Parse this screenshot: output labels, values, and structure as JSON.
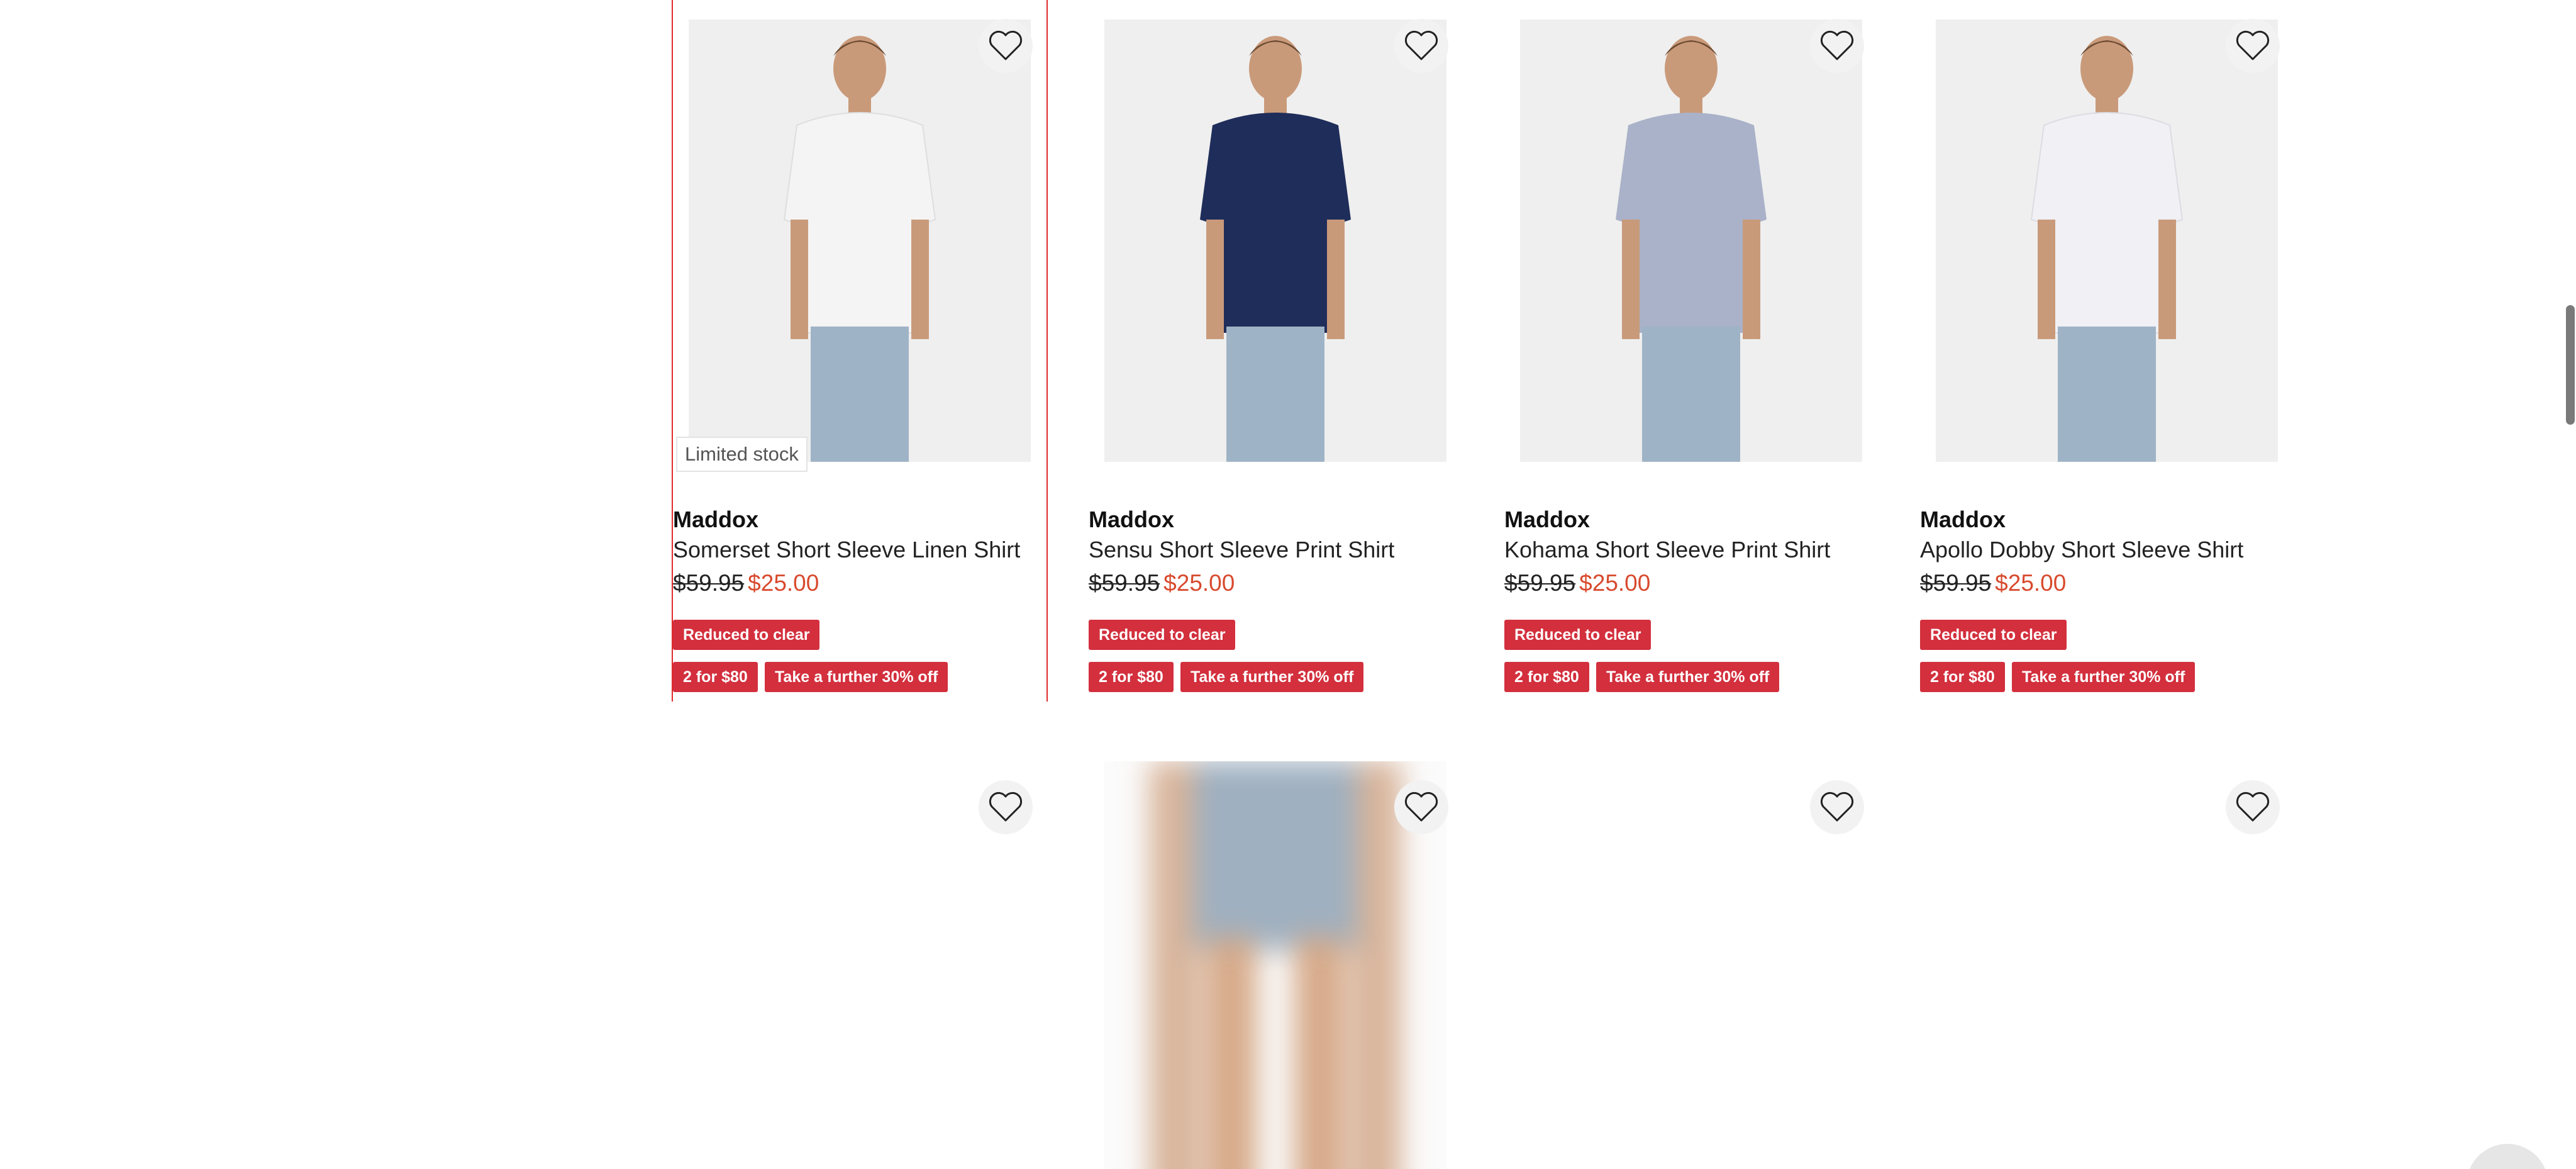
{
  "products_row1": [
    {
      "brand": "Maddox",
      "title": "Somerset Short Sleeve Linen Shirt",
      "old_price": "$59.95",
      "new_price": "$25.00",
      "badges": [
        "Reduced to clear",
        "2 for $80",
        "Take a further 30% off"
      ],
      "stock_label": "Limited stock",
      "shirt_color": "#f4f4f4",
      "selected": true
    },
    {
      "brand": "Maddox",
      "title": "Sensu Short Sleeve Print Shirt",
      "old_price": "$59.95",
      "new_price": "$25.00",
      "badges": [
        "Reduced to clear",
        "2 for $80",
        "Take a further 30% off"
      ],
      "shirt_color": "#1f2d5a"
    },
    {
      "brand": "Maddox",
      "title": "Kohama Short Sleeve Print Shirt",
      "old_price": "$59.95",
      "new_price": "$25.00",
      "badges": [
        "Reduced to clear",
        "2 for $80",
        "Take a further 30% off"
      ],
      "shirt_color": "#a9b2c8"
    },
    {
      "brand": "Maddox",
      "title": "Apollo Dobby Short Sleeve Shirt",
      "old_price": "$59.95",
      "new_price": "$25.00",
      "badges": [
        "Reduced to clear",
        "2 for $80",
        "Take a further 30% off"
      ],
      "shirt_color": "#f0f0f5"
    }
  ],
  "colors": {
    "badge_red": "#d32f3d",
    "sale_price": "#d84a2e",
    "selection_outline": "#e02b2b"
  },
  "icons": {
    "wishlist": "heart-outline-icon"
  }
}
